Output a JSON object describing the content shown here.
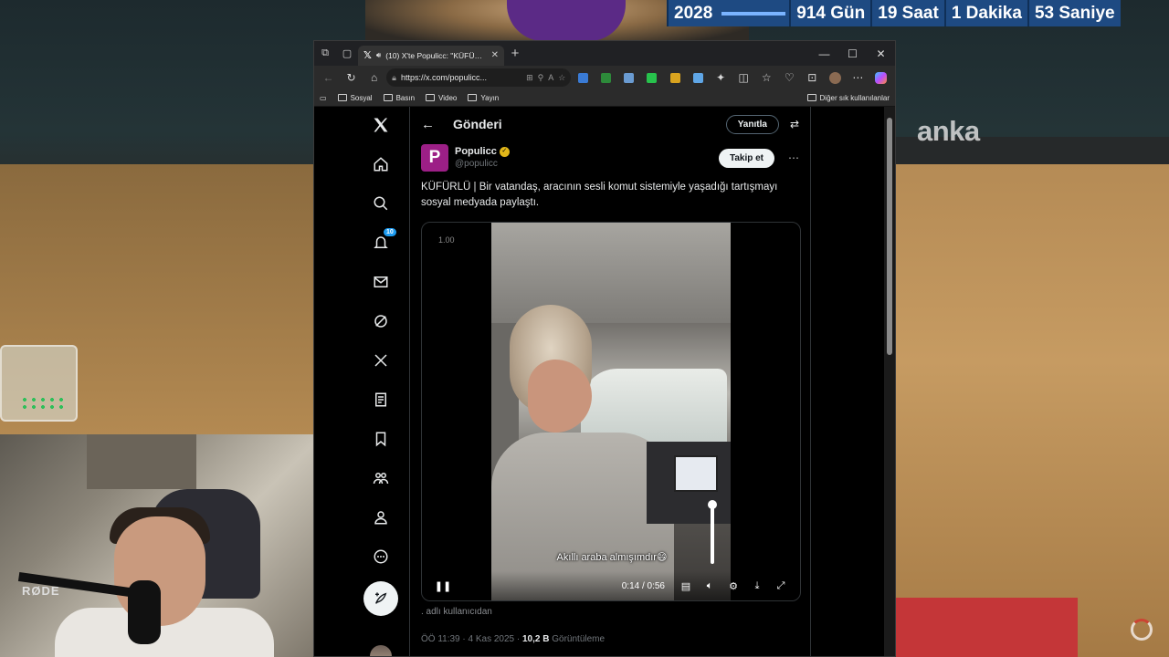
{
  "background": {
    "counter": {
      "year": "2028",
      "days": "914 Gün",
      "hours": "19 Saat",
      "minutes": "1 Dakika",
      "seconds": "53 Saniye"
    },
    "channel_logo": "anka",
    "mic_brand": "RØDE"
  },
  "browser": {
    "tab": {
      "title": "(10) X'te Populicc: \"KÜFÜRLÜ"
    },
    "address": {
      "url": "https://x.com/populicc..."
    },
    "bookmarks": [
      "Sosyal",
      "Basın",
      "Video",
      "Yayın"
    ],
    "other_bookmarks": "Diğer sık kullanılanlar"
  },
  "x_page": {
    "sidebar": {
      "notifications_badge": "10"
    },
    "header": {
      "title": "Gönderi",
      "reply_label": "Yanıtla"
    },
    "author": {
      "initial": "P",
      "name": "Populicc",
      "handle": "@populicc",
      "follow_label": "Takip et"
    },
    "tweet": {
      "text": "KÜFÜRLÜ | Bir vatandaş, aracının sesli komut sistemiyle yaşadığı tartışmayı sosyal medyada paylaştı."
    },
    "video": {
      "playback_rate": "1.00",
      "subtitle": "Akıllı araba almışımdır😄",
      "time": "0:14 / 0:56",
      "volume_level": 1.0
    },
    "attribution": ". adlı kullanıcıdan",
    "meta": {
      "time": "ÖÖ 11:39 · 4 Kas 2025 · ",
      "views": "10,2 B",
      "views_label": " Görüntüleme"
    }
  }
}
